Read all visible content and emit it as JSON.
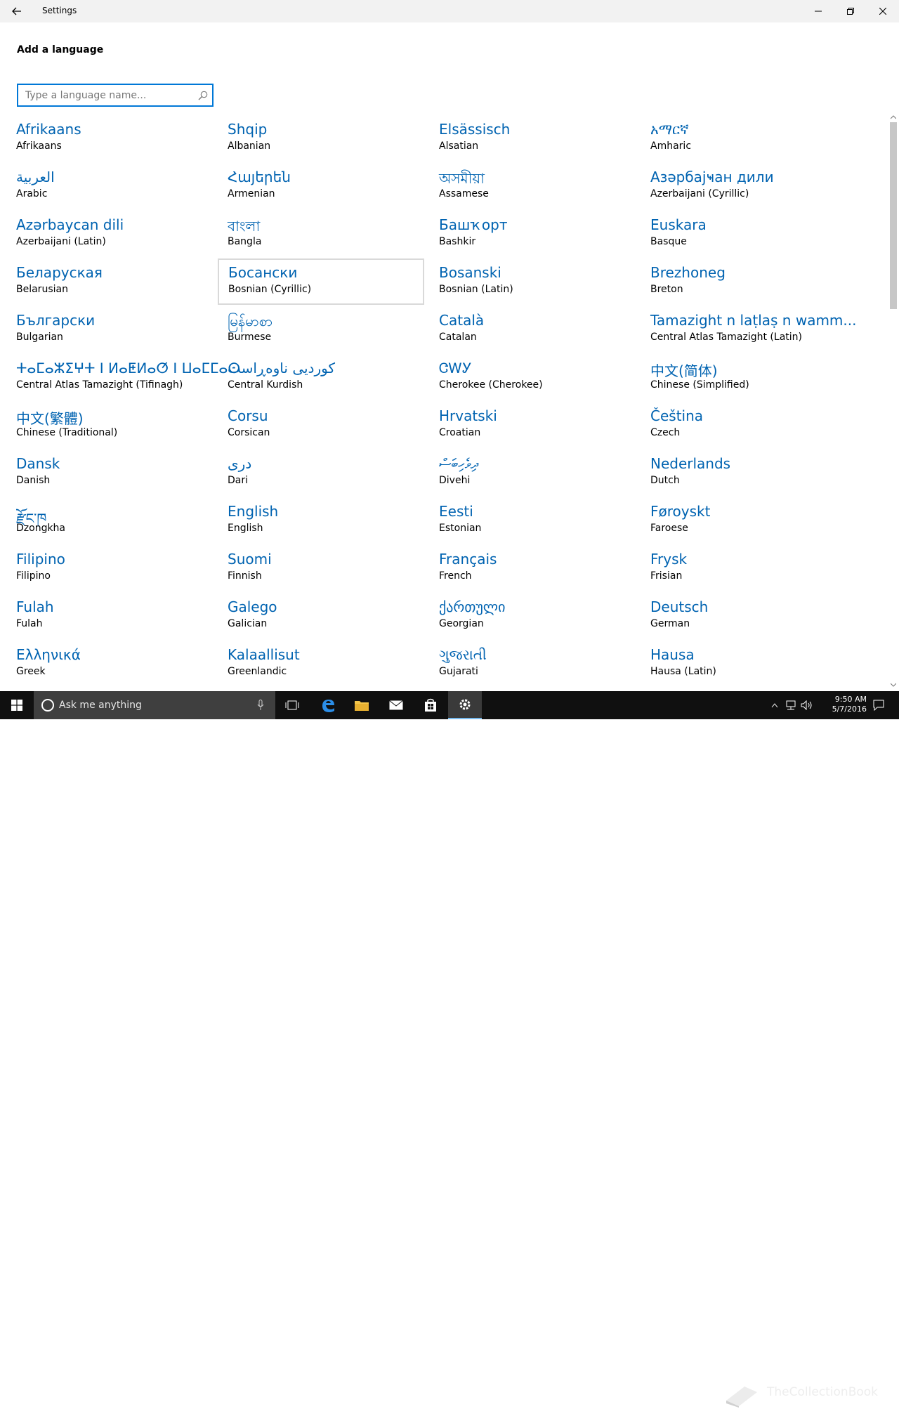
{
  "window": {
    "title": "Settings",
    "icons": {
      "back": "back-arrow-icon",
      "minimize": "minimize-icon",
      "restore": "restore-icon",
      "close": "close-icon"
    }
  },
  "page": {
    "title": "Add a language",
    "search_placeholder": "Type a language name...",
    "search_icon": "search-icon"
  },
  "languages": [
    {
      "native": "Afrikaans",
      "english": "Afrikaans"
    },
    {
      "native": "Shqip",
      "english": "Albanian"
    },
    {
      "native": "Elsässisch",
      "english": "Alsatian"
    },
    {
      "native": "አማርኛ",
      "english": "Amharic"
    },
    {
      "native": "العربية",
      "english": "Arabic"
    },
    {
      "native": "Հայերեն",
      "english": "Armenian"
    },
    {
      "native": "অসমীয়া",
      "english": "Assamese"
    },
    {
      "native": "Азәрбајҹан дили",
      "english": "Azerbaijani (Cyrillic)"
    },
    {
      "native": "Azərbaycan dili",
      "english": "Azerbaijani (Latin)"
    },
    {
      "native": "বাংলা",
      "english": "Bangla"
    },
    {
      "native": "Башҡорт",
      "english": "Bashkir"
    },
    {
      "native": "Euskara",
      "english": "Basque"
    },
    {
      "native": "Беларуская",
      "english": "Belarusian"
    },
    {
      "native": "Босански",
      "english": "Bosnian (Cyrillic)"
    },
    {
      "native": "Bosanski",
      "english": "Bosnian (Latin)"
    },
    {
      "native": "Brezhoneg",
      "english": "Breton"
    },
    {
      "native": "Български",
      "english": "Bulgarian"
    },
    {
      "native": "မြန်မာစာ",
      "english": "Burmese"
    },
    {
      "native": "Català",
      "english": "Catalan"
    },
    {
      "native": "Tamazight n laṭlaṣ n wamm...",
      "english": "Central Atlas Tamazight (Latin)"
    },
    {
      "native": "ⵜⴰⵎⴰⵣⵉⵖⵜ ⵏ ⵍⴰⵟⵍⴰⵚ ⵏ ⵡⴰⵎⵎⴰⵙ",
      "english": "Central Atlas Tamazight (Tifinagh)"
    },
    {
      "native": "کوردیی ناوەڕاست",
      "english": "Central Kurdish"
    },
    {
      "native": "ᏣᎳᎩ",
      "english": "Cherokee (Cherokee)"
    },
    {
      "native": "中文(简体)",
      "english": "Chinese (Simplified)"
    },
    {
      "native": "中文(繁體)",
      "english": "Chinese (Traditional)"
    },
    {
      "native": "Corsu",
      "english": "Corsican"
    },
    {
      "native": "Hrvatski",
      "english": "Croatian"
    },
    {
      "native": "Čeština",
      "english": "Czech"
    },
    {
      "native": "Dansk",
      "english": "Danish"
    },
    {
      "native": "درى",
      "english": "Dari"
    },
    {
      "native": "ދިވެހިބަސް",
      "english": "Divehi"
    },
    {
      "native": "Nederlands",
      "english": "Dutch"
    },
    {
      "native": "རྫོང་ཁ",
      "english": "Dzongkha"
    },
    {
      "native": "English",
      "english": "English"
    },
    {
      "native": "Eesti",
      "english": "Estonian"
    },
    {
      "native": "Føroyskt",
      "english": "Faroese"
    },
    {
      "native": "Filipino",
      "english": "Filipino"
    },
    {
      "native": "Suomi",
      "english": "Finnish"
    },
    {
      "native": "Français",
      "english": "French"
    },
    {
      "native": "Frysk",
      "english": "Frisian"
    },
    {
      "native": "Fulah",
      "english": "Fulah"
    },
    {
      "native": "Galego",
      "english": "Galician"
    },
    {
      "native": "ქართული",
      "english": "Georgian"
    },
    {
      "native": "Deutsch",
      "english": "German"
    },
    {
      "native": "Ελληνικά",
      "english": "Greek"
    },
    {
      "native": "Kalaallisut",
      "english": "Greenlandic"
    },
    {
      "native": "ગુજરાતી",
      "english": "Gujarati"
    },
    {
      "native": "Hausa",
      "english": "Hausa (Latin)"
    }
  ],
  "taskbar": {
    "search_placeholder": "Ask me anything",
    "icons": [
      "windows-start-icon",
      "cortana-circle-icon",
      "microphone-icon",
      "task-view-icon",
      "edge-icon",
      "file-explorer-icon",
      "mail-icon",
      "store-icon",
      "settings-gear-icon"
    ],
    "clock_time": "9:50 AM",
    "clock_date": "5/7/2016",
    "watermark": "TheCollectionBook",
    "accent": "#0078d7"
  }
}
